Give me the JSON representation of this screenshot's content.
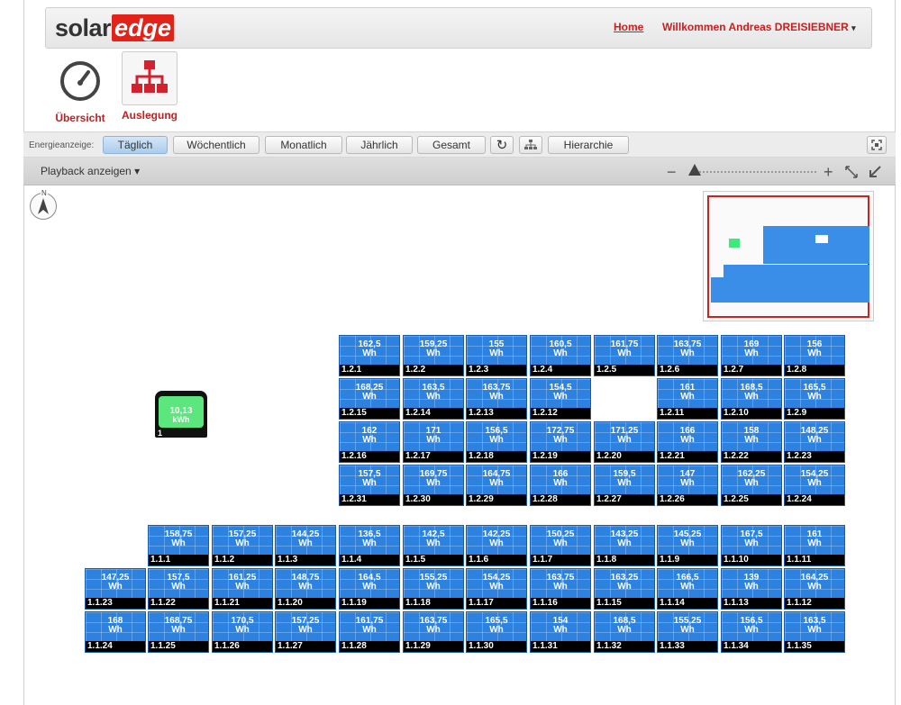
{
  "header": {
    "logo_solar": "solar",
    "logo_edge": "edge",
    "home": "Home",
    "welcome": "Willkommen Andreas DREISIEBNER"
  },
  "nav": {
    "overview": "Übersicht",
    "layout": "Auslegung"
  },
  "toolbar": {
    "label": "Energieanzeige:",
    "daily": "Täglich",
    "weekly": "Wöchentlich",
    "monthly": "Monatlich",
    "yearly": "Jährlich",
    "total": "Gesamt",
    "hierarchy": "Hierarchie"
  },
  "subbar": {
    "playback": "Playback anzeigen ▾"
  },
  "compass_label": "N",
  "inverter": {
    "value": "10,13",
    "unit": "kWh",
    "id": "1"
  },
  "unit": "Wh",
  "panels_upper": [
    {
      "v": "162,5",
      "id": "1.2.1"
    },
    {
      "v": "159,25",
      "id": "1.2.2"
    },
    {
      "v": "155",
      "id": "1.2.3"
    },
    {
      "v": "160,5",
      "id": "1.2.4"
    },
    {
      "v": "161,75",
      "id": "1.2.5"
    },
    {
      "v": "163,75",
      "id": "1.2.6"
    },
    {
      "v": "169",
      "id": "1.2.7"
    },
    {
      "v": "156",
      "id": "1.2.8"
    },
    {
      "v": "168,25",
      "id": "1.2.15"
    },
    {
      "v": "163,5",
      "id": "1.2.14"
    },
    {
      "v": "163,75",
      "id": "1.2.13"
    },
    {
      "v": "154,5",
      "id": "1.2.12"
    },
    {
      "v": "161",
      "id": "1.2.11"
    },
    {
      "v": "168,5",
      "id": "1.2.10"
    },
    {
      "v": "165,5",
      "id": "1.2.9"
    },
    {
      "v": "162",
      "id": "1.2.16"
    },
    {
      "v": "171",
      "id": "1.2.17"
    },
    {
      "v": "156,5",
      "id": "1.2.18"
    },
    {
      "v": "172,75",
      "id": "1.2.19"
    },
    {
      "v": "171,25",
      "id": "1.2.20"
    },
    {
      "v": "166",
      "id": "1.2.21"
    },
    {
      "v": "158",
      "id": "1.2.22"
    },
    {
      "v": "148,25",
      "id": "1.2.23"
    },
    {
      "v": "157,5",
      "id": "1.2.31"
    },
    {
      "v": "169,75",
      "id": "1.2.30"
    },
    {
      "v": "164,75",
      "id": "1.2.29"
    },
    {
      "v": "166",
      "id": "1.2.28"
    },
    {
      "v": "159,5",
      "id": "1.2.27"
    },
    {
      "v": "147",
      "id": "1.2.26"
    },
    {
      "v": "162,25",
      "id": "1.2.25"
    },
    {
      "v": "154,25",
      "id": "1.2.24"
    }
  ],
  "panels_lower": [
    {
      "v": "158,75",
      "id": "1.1.1"
    },
    {
      "v": "157,25",
      "id": "1.1.2"
    },
    {
      "v": "144,25",
      "id": "1.1.3"
    },
    {
      "v": "136,5",
      "id": "1.1.4"
    },
    {
      "v": "142,5",
      "id": "1.1.5"
    },
    {
      "v": "142,25",
      "id": "1.1.6"
    },
    {
      "v": "150,25",
      "id": "1.1.7"
    },
    {
      "v": "143,25",
      "id": "1.1.8"
    },
    {
      "v": "145,25",
      "id": "1.1.9"
    },
    {
      "v": "167,5",
      "id": "1.1.10"
    },
    {
      "v": "161",
      "id": "1.1.11"
    },
    {
      "v": "147,25",
      "id": "1.1.23"
    },
    {
      "v": "157,5",
      "id": "1.1.22"
    },
    {
      "v": "161,25",
      "id": "1.1.21"
    },
    {
      "v": "148,75",
      "id": "1.1.20"
    },
    {
      "v": "164,5",
      "id": "1.1.19"
    },
    {
      "v": "155,25",
      "id": "1.1.18"
    },
    {
      "v": "154,25",
      "id": "1.1.17"
    },
    {
      "v": "163,75",
      "id": "1.1.16"
    },
    {
      "v": "163,25",
      "id": "1.1.15"
    },
    {
      "v": "166,5",
      "id": "1.1.14"
    },
    {
      "v": "139",
      "id": "1.1.13"
    },
    {
      "v": "164,25",
      "id": "1.1.12"
    },
    {
      "v": "168",
      "id": "1.1.24"
    },
    {
      "v": "168,75",
      "id": "1.1.25"
    },
    {
      "v": "170,5",
      "id": "1.1.26"
    },
    {
      "v": "157,25",
      "id": "1.1.27"
    },
    {
      "v": "161,75",
      "id": "1.1.28"
    },
    {
      "v": "163,75",
      "id": "1.1.29"
    },
    {
      "v": "165,5",
      "id": "1.1.30"
    },
    {
      "v": "154",
      "id": "1.1.31"
    },
    {
      "v": "168,5",
      "id": "1.1.32"
    },
    {
      "v": "155,25",
      "id": "1.1.33"
    },
    {
      "v": "156,5",
      "id": "1.1.34"
    },
    {
      "v": "163,5",
      "id": "1.1.35"
    }
  ],
  "colors": {
    "panel": "#2d82e0",
    "inverter_screen": "#5ce67e",
    "brand_red": "#e2231a"
  }
}
